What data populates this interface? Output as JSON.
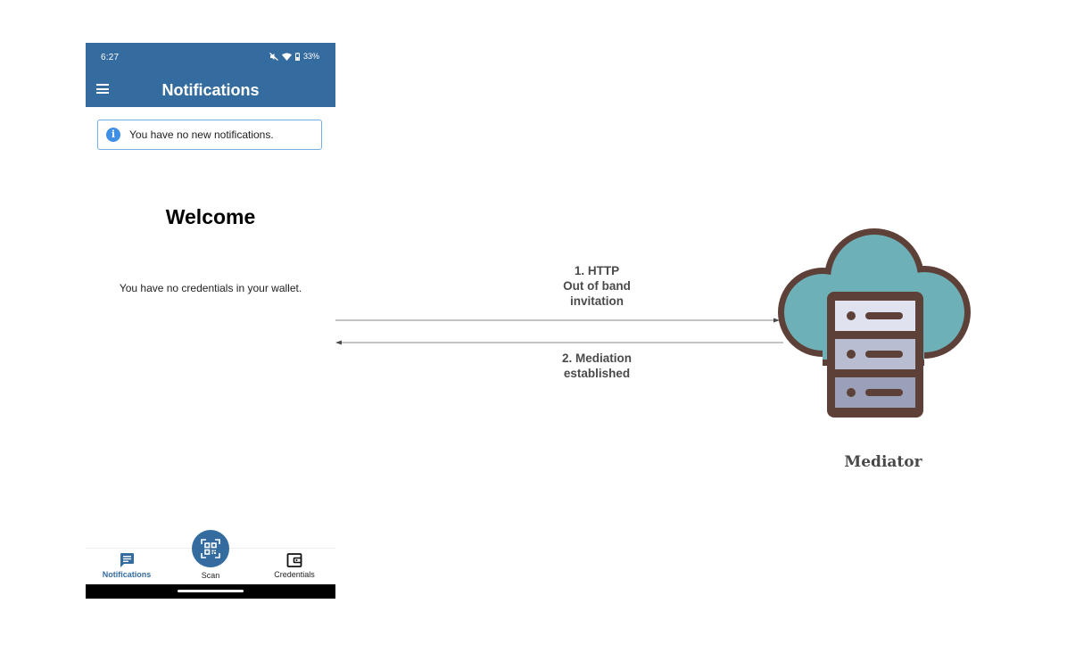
{
  "phone": {
    "status_time": "6:27",
    "battery": "33%",
    "title": "Notifications",
    "info_banner": "You have no new notifications.",
    "welcome": "Welcome",
    "empty_message": "You have no credentials in your wallet.",
    "nav": {
      "notifications": "Notifications",
      "scan": "Scan",
      "credentials": "Credentials"
    },
    "colors": {
      "app_bar": "#356ca0",
      "info_border": "#76aee0",
      "info_icon": "#3f8fe6"
    }
  },
  "diagram": {
    "arrow_1_label": "1. HTTP\nOut of band\ninvitation",
    "arrow_2_label": "2. Mediation\nestablished",
    "node_label": "Mediator",
    "node_icon": "cloud-server-icon",
    "colors": {
      "cloud": "#6eb0b7",
      "outline": "#5d4037",
      "server": "#e0e2ef",
      "server_shade": "#9aa0b8"
    }
  }
}
